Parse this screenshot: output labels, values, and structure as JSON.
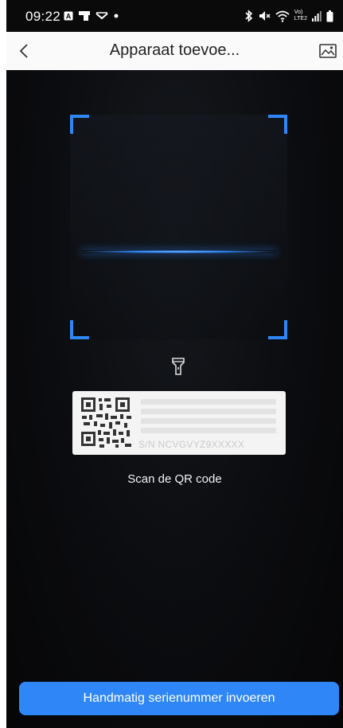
{
  "status_bar": {
    "time": "09:22",
    "left_icons": [
      "notification-a-icon",
      "notification-app-icon",
      "notification-dropdown-icon",
      "notification-dot-icon"
    ],
    "right_icons": [
      "bluetooth-icon",
      "mute-icon",
      "wifi-icon",
      "volte-icon",
      "signal-icon",
      "battery-icon"
    ],
    "volte_line1": "Vo)",
    "volte_line2": "LTE2"
  },
  "nav": {
    "title": "Apparaat toevoe...",
    "back_icon": "chevron-left-icon",
    "gallery_icon": "image-gallery-icon"
  },
  "scanner": {
    "accent_color": "#2f86f6",
    "torch_icon": "flashlight-icon",
    "sample_card": {
      "sn_text": "S/N  NCVGVYZ9XXXXX"
    },
    "instruction": "Scan de QR code"
  },
  "footer": {
    "manual_button_label": "Handmatig serienummer invoeren"
  }
}
